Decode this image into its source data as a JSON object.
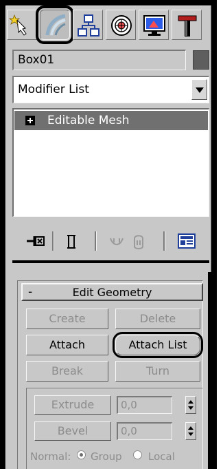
{
  "command_panel": {
    "tabs": [
      {
        "id": "create",
        "icon": "star-arrow-icon",
        "active": false,
        "highlight": false
      },
      {
        "id": "modify",
        "icon": "modify-arc-icon",
        "active": true,
        "highlight": true
      },
      {
        "id": "hierarchy",
        "icon": "hierarchy-icon",
        "active": false,
        "highlight": false
      },
      {
        "id": "motion",
        "icon": "motion-icon",
        "active": false,
        "highlight": false
      },
      {
        "id": "display",
        "icon": "display-monitor-icon",
        "active": false,
        "highlight": false
      },
      {
        "id": "utilities",
        "icon": "hammer-icon",
        "active": false,
        "highlight": false
      }
    ],
    "object_name": "Box01",
    "object_color": "#5e5e5e",
    "modifier_list": {
      "selected": "Modifier List"
    },
    "stack": {
      "items": [
        {
          "expand": "+",
          "label": "Editable Mesh"
        }
      ]
    },
    "stack_toolbar": {
      "icons": [
        "pin-stack-icon",
        "show-end-result-icon",
        "make-unique-icon",
        "remove-modifier-icon",
        "configure-modifier-sets-icon"
      ]
    },
    "rollout": {
      "toggle": "-",
      "title": "Edit Geometry",
      "buttons": {
        "create": "Create",
        "delete": "Delete",
        "attach": "Attach",
        "attach_list": "Attach List",
        "break": "Break",
        "turn": "Turn",
        "extrude": "Extrude",
        "bevel": "Bevel"
      },
      "extrude_value": "0,0",
      "bevel_value": "0,0",
      "normal": {
        "label": "Normal:",
        "group": "Group",
        "local": "Local",
        "selected": "Group"
      }
    }
  }
}
